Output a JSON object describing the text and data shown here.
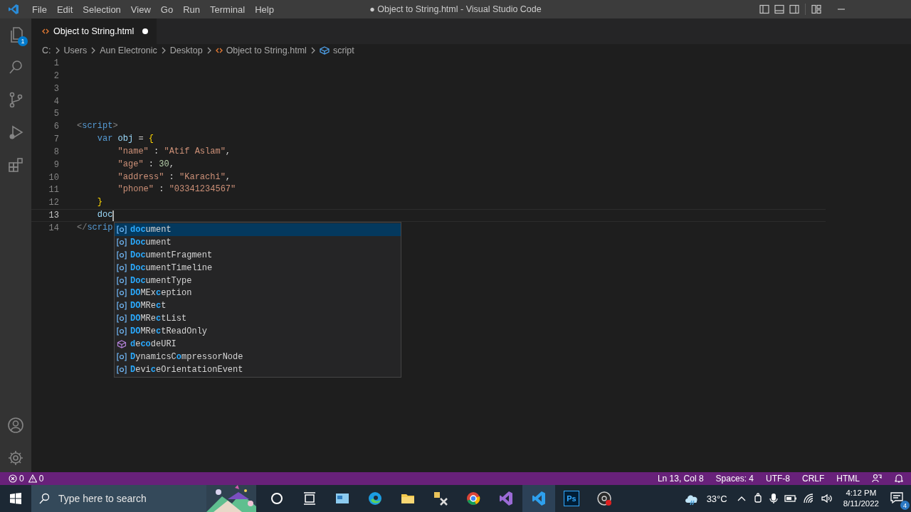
{
  "window": {
    "title": "● Object to String.html - Visual Studio Code"
  },
  "menu": [
    "File",
    "Edit",
    "Selection",
    "View",
    "Go",
    "Run",
    "Terminal",
    "Help"
  ],
  "activity_bar": {
    "items": [
      {
        "kind": "explorer",
        "badge": "1"
      },
      {
        "kind": "search"
      },
      {
        "kind": "source-control"
      },
      {
        "kind": "run"
      },
      {
        "kind": "extensions"
      }
    ],
    "bottom": [
      {
        "kind": "account"
      },
      {
        "kind": "settings"
      }
    ]
  },
  "tabs": [
    {
      "label": "Object to String.html",
      "selected": true,
      "modified": true
    }
  ],
  "breadcrumb": [
    {
      "label": "C:",
      "kind": "folder"
    },
    {
      "label": "Users",
      "kind": "folder"
    },
    {
      "label": "Aun Electronic",
      "kind": "folder"
    },
    {
      "label": "Desktop",
      "kind": "folder"
    },
    {
      "label": "Object to String.html",
      "kind": "file"
    },
    {
      "label": "script",
      "kind": "symbol"
    }
  ],
  "editor": {
    "lines": [
      {
        "number": "1",
        "current": false
      },
      {
        "number": "2",
        "current": false
      },
      {
        "number": "3",
        "current": false
      },
      {
        "number": "4",
        "current": false
      },
      {
        "number": "5",
        "current": false
      },
      {
        "number": "6",
        "current": false,
        "tokens": [
          {
            "text": "<",
            "kind": "bracket"
          },
          {
            "text": "script",
            "kind": "tag"
          },
          {
            "text": ">",
            "kind": "bracket"
          }
        ]
      },
      {
        "number": "7",
        "current": false,
        "tokens": [
          {
            "text": "    var",
            "kind": "keyword"
          },
          {
            "text": " obj ",
            "kind": "variable"
          },
          {
            "text": "= ",
            "kind": "punct"
          },
          {
            "text": "{",
            "kind": "brace"
          }
        ]
      },
      {
        "number": "8",
        "current": false,
        "tokens": [
          {
            "text": "        \"name\"",
            "kind": "string"
          },
          {
            "text": " : ",
            "kind": "punct"
          },
          {
            "text": "\"Atif Aslam\"",
            "kind": "string"
          },
          {
            "text": ",",
            "kind": "punct"
          }
        ]
      },
      {
        "number": "9",
        "current": false,
        "tokens": [
          {
            "text": "        \"age\"",
            "kind": "string"
          },
          {
            "text": " : ",
            "kind": "punct"
          },
          {
            "text": "30",
            "kind": "number"
          },
          {
            "text": ",",
            "kind": "punct"
          }
        ]
      },
      {
        "number": "10",
        "current": false,
        "tokens": [
          {
            "text": "        \"address\"",
            "kind": "string"
          },
          {
            "text": " : ",
            "kind": "punct"
          },
          {
            "text": "\"Karachi\"",
            "kind": "string"
          },
          {
            "text": ",",
            "kind": "punct"
          }
        ]
      },
      {
        "number": "11",
        "current": false,
        "tokens": [
          {
            "text": "        \"phone\"",
            "kind": "string"
          },
          {
            "text": " : ",
            "kind": "punct"
          },
          {
            "text": "\"03341234567\"",
            "kind": "string"
          }
        ]
      },
      {
        "number": "12",
        "current": false,
        "tokens": [
          {
            "text": "    }",
            "kind": "brace"
          }
        ]
      },
      {
        "number": "13",
        "current": true,
        "tokens": [
          {
            "text": "    doc",
            "kind": "plain"
          }
        ]
      },
      {
        "number": "14",
        "current": false,
        "tokens": [
          {
            "text": "</",
            "kind": "bracket"
          },
          {
            "text": "scrip",
            "kind": "tag"
          }
        ]
      }
    ]
  },
  "suggestions": [
    {
      "kind": "variable",
      "selected": true,
      "parts": [
        {
          "text": "doc",
          "match": true
        },
        {
          "text": "ument",
          "match": false
        }
      ]
    },
    {
      "kind": "variable",
      "selected": false,
      "parts": [
        {
          "text": "Doc",
          "match": true
        },
        {
          "text": "ument",
          "match": false
        }
      ]
    },
    {
      "kind": "variable",
      "selected": false,
      "parts": [
        {
          "text": "Doc",
          "match": true
        },
        {
          "text": "umentFragment",
          "match": false
        }
      ]
    },
    {
      "kind": "variable",
      "selected": false,
      "parts": [
        {
          "text": "Doc",
          "match": true
        },
        {
          "text": "umentTimeline",
          "match": false
        }
      ]
    },
    {
      "kind": "variable",
      "selected": false,
      "parts": [
        {
          "text": "Doc",
          "match": true
        },
        {
          "text": "umentType",
          "match": false
        }
      ]
    },
    {
      "kind": "variable",
      "selected": false,
      "parts": [
        {
          "text": "DO",
          "match": true
        },
        {
          "text": "MEx",
          "match": false
        },
        {
          "text": "c",
          "match": true
        },
        {
          "text": "eption",
          "match": false
        }
      ]
    },
    {
      "kind": "variable",
      "selected": false,
      "parts": [
        {
          "text": "DO",
          "match": true
        },
        {
          "text": "MRe",
          "match": false
        },
        {
          "text": "c",
          "match": true
        },
        {
          "text": "t",
          "match": false
        }
      ]
    },
    {
      "kind": "variable",
      "selected": false,
      "parts": [
        {
          "text": "DO",
          "match": true
        },
        {
          "text": "MRe",
          "match": false
        },
        {
          "text": "c",
          "match": true
        },
        {
          "text": "tList",
          "match": false
        }
      ]
    },
    {
      "kind": "variable",
      "selected": false,
      "parts": [
        {
          "text": "DO",
          "match": true
        },
        {
          "text": "MRe",
          "match": false
        },
        {
          "text": "c",
          "match": true
        },
        {
          "text": "tReadOnly",
          "match": false
        }
      ]
    },
    {
      "kind": "function",
      "selected": false,
      "parts": [
        {
          "text": "d",
          "match": true
        },
        {
          "text": "e",
          "match": false
        },
        {
          "text": "co",
          "match": true
        },
        {
          "text": "deURI",
          "match": false
        }
      ]
    },
    {
      "kind": "variable",
      "selected": false,
      "parts": [
        {
          "text": "D",
          "match": true
        },
        {
          "text": "ynamicsC",
          "match": false
        },
        {
          "text": "o",
          "match": true
        },
        {
          "text": "mpressorNode",
          "match": false
        }
      ]
    },
    {
      "kind": "variable",
      "selected": false,
      "parts": [
        {
          "text": "D",
          "match": true
        },
        {
          "text": "evi",
          "match": false
        },
        {
          "text": "c",
          "match": true
        },
        {
          "text": "eOrientationEvent",
          "match": false
        }
      ]
    }
  ],
  "status_bar": {
    "errors": "0",
    "warnings": "0",
    "items": [
      "Ln 13, Col 8",
      "Spaces: 4",
      "UTF-8",
      "CRLF",
      "HTML"
    ]
  },
  "taskbar": {
    "search": {
      "placeholder": "Type here to search"
    },
    "apps": [
      {
        "kind": "cortana",
        "active": false
      },
      {
        "kind": "task-view",
        "active": false
      },
      {
        "kind": "app-window",
        "active": false
      },
      {
        "kind": "edge",
        "active": false
      },
      {
        "kind": "file-explorer",
        "active": false
      },
      {
        "kind": "tools",
        "active": false
      },
      {
        "kind": "chrome",
        "active": false
      },
      {
        "kind": "visual-studio",
        "active": false
      },
      {
        "kind": "vscode",
        "active": true
      },
      {
        "kind": "photoshop",
        "active": false,
        "label": "Ps"
      },
      {
        "kind": "recorder",
        "active": false
      }
    ],
    "weather": "33°C",
    "time": "4:12 PM",
    "date": "8/11/2022",
    "notifications": "4"
  }
}
